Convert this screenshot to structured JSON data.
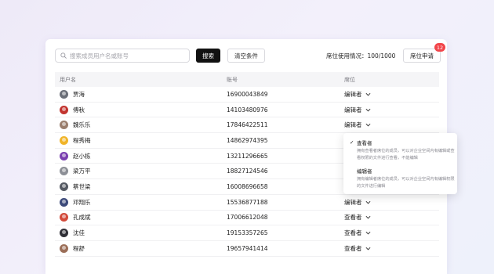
{
  "toolbar": {
    "search_placeholder": "搜索成员用户名或账号",
    "search_label": "搜索",
    "clear_label": "清空条件",
    "usage_text": "席位使用情况：100/1000",
    "apply_label": "席位申请",
    "apply_badge": "12"
  },
  "table": {
    "headers": {
      "name": "用户名",
      "account": "账号",
      "seat": "席位"
    },
    "rows": [
      {
        "name": "贾海",
        "account": "16900043849",
        "seat": "编辑者",
        "avatar_color": "#6b6f78"
      },
      {
        "name": "傅秋",
        "account": "14103480976",
        "seat": "编辑者",
        "avatar_color": "#c2332e"
      },
      {
        "name": "魏乐乐",
        "account": "17846422511",
        "seat": "编辑者",
        "avatar_color": "#9a7e6d"
      },
      {
        "name": "程秀梅",
        "account": "14862974395",
        "seat": "",
        "avatar_color": "#f0b429"
      },
      {
        "name": "赵小栋",
        "account": "13211296665",
        "seat": "",
        "avatar_color": "#7a3fb0"
      },
      {
        "name": "梁万平",
        "account": "18827124546",
        "seat": "",
        "avatar_color": "#8c8f96"
      },
      {
        "name": "蔡世梁",
        "account": "16008696658",
        "seat": "",
        "avatar_color": "#555a63"
      },
      {
        "name": "邓翔乐",
        "account": "15536877188",
        "seat": "编辑者",
        "avatar_color": "#3c4a7a"
      },
      {
        "name": "孔成斌",
        "account": "17006612048",
        "seat": "查看者",
        "avatar_color": "#d24a3a"
      },
      {
        "name": "沈佳",
        "account": "19153357265",
        "seat": "查看者",
        "avatar_color": "#2f2f36"
      },
      {
        "name": "程舒",
        "account": "19657941414",
        "seat": "查看者",
        "avatar_color": "#9b6e58"
      }
    ]
  },
  "dropdown": {
    "options": [
      {
        "title": "查看者",
        "desc": "拥有查看者席位的成员，可以对企业空间内有编辑或查看权限的文件进行查看，不能编辑",
        "selected": true
      },
      {
        "title": "编辑者",
        "desc": "拥有编辑者席位的成员，可以对企业空间内有编辑权限的文件进行编辑",
        "selected": false
      }
    ]
  }
}
